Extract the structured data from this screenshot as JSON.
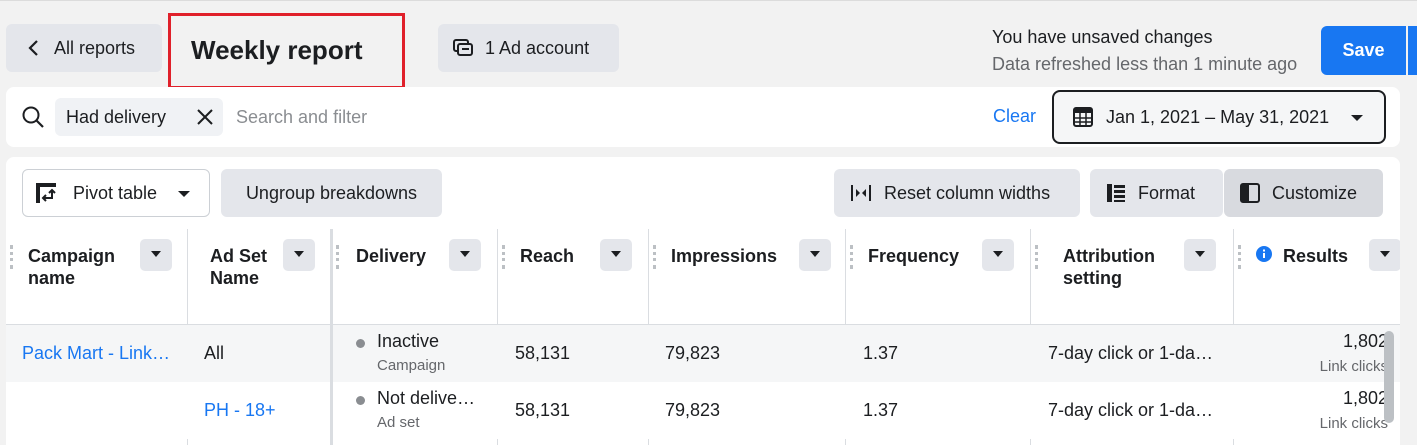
{
  "header": {
    "back_label": "All reports",
    "title": "Weekly report",
    "ad_account_label": "1 Ad account",
    "unsaved_text": "You have unsaved changes",
    "refreshed_text": "Data refreshed less than 1 minute ago",
    "save_label": "Save"
  },
  "filter": {
    "chip_label": "Had delivery",
    "placeholder": "Search and filter",
    "clear_label": "Clear",
    "date_range": "Jan 1, 2021 – May 31, 2021"
  },
  "toolbar": {
    "pivot_label": "Pivot table",
    "ungroup_label": "Ungroup breakdowns",
    "reset_label": "Reset column widths",
    "format_label": "Format",
    "customize_label": "Customize"
  },
  "table": {
    "columns": [
      "Campaign name",
      "Ad Set Name",
      "Delivery",
      "Reach",
      "Impressions",
      "Frequency",
      "Attribution setting",
      "Results"
    ],
    "rows": [
      {
        "campaign": "Pack Mart - Link…",
        "adset": "All",
        "delivery": "Inactive",
        "delivery_sub": "Campaign",
        "reach": "58,131",
        "impressions": "79,823",
        "frequency": "1.37",
        "attribution": "7-day click or 1-da…",
        "results": "1,802",
        "results_sub": "Link clicks"
      },
      {
        "campaign": "",
        "adset": "PH - 18+",
        "delivery": "Not delive…",
        "delivery_sub": "Ad set",
        "reach": "58,131",
        "impressions": "79,823",
        "frequency": "1.37",
        "attribution": "7-day click or 1-da…",
        "results": "1,802",
        "results_sub": "Link clicks"
      }
    ]
  },
  "colors": {
    "accent": "#1877f2",
    "highlight_box": "#e0202a"
  }
}
